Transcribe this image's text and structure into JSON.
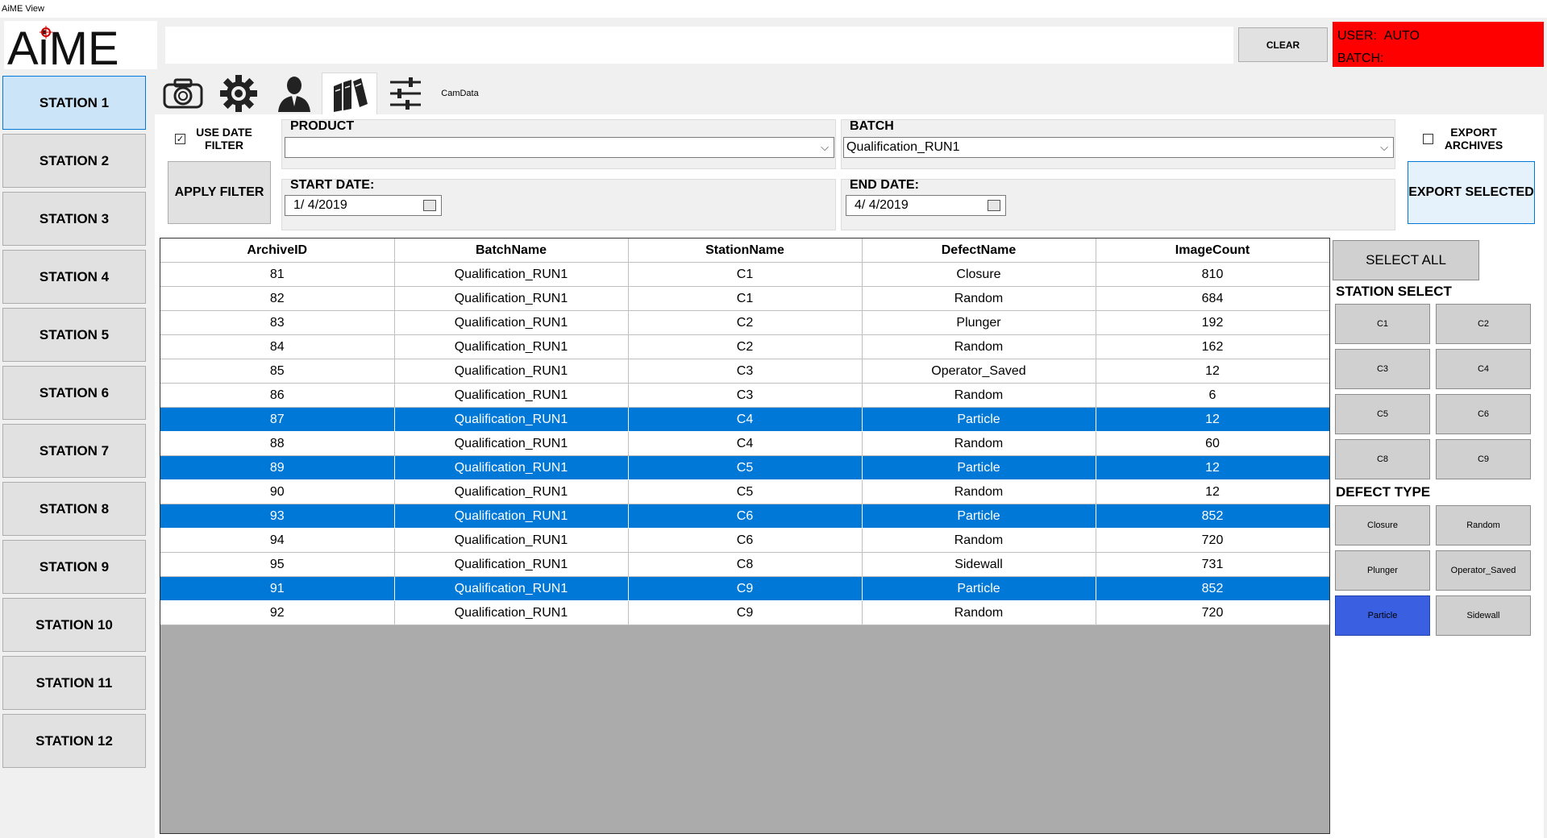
{
  "window": {
    "title": "AiME View"
  },
  "logo": {
    "text": "AiME"
  },
  "header": {
    "clear_label": "CLEAR",
    "user_label": "USER:",
    "user_value": "AUTO",
    "batch_label": "BATCH:",
    "batch_value": ""
  },
  "stations": [
    "STATION 1",
    "STATION 2",
    "STATION 3",
    "STATION 4",
    "STATION 5",
    "STATION 6",
    "STATION 7",
    "STATION 8",
    "STATION 9",
    "STATION 10",
    "STATION 11",
    "STATION 12"
  ],
  "tabs": [
    {
      "icon": "camera-icon"
    },
    {
      "icon": "gear-icon"
    },
    {
      "icon": "user-icon"
    },
    {
      "icon": "archive-books-icon"
    },
    {
      "icon": "sliders-icon"
    },
    {
      "label": "CamData"
    }
  ],
  "filters": {
    "use_date_filter_label": "USE DATE FILTER",
    "use_date_filter_checked": true,
    "apply_filter_label": "APPLY FILTER",
    "product_label": "PRODUCT",
    "product_value": "",
    "batch_label": "BATCH",
    "batch_value": "Qualification_RUN1",
    "start_date_label": "START DATE:",
    "start_date_value": "1/  4/2019",
    "end_date_label": "END DATE:",
    "end_date_value": "4/  4/2019",
    "export_archives_label": "EXPORT ARCHIVES",
    "export_archives_checked": false,
    "export_selected_label": "EXPORT SELECTED"
  },
  "grid": {
    "columns": [
      "ArchiveID",
      "BatchName",
      "StationName",
      "DefectName",
      "ImageCount"
    ],
    "rows": [
      {
        "id": "81",
        "batch": "Qualification_RUN1",
        "station": "C1",
        "defect": "Closure",
        "count": "810",
        "selected": false
      },
      {
        "id": "82",
        "batch": "Qualification_RUN1",
        "station": "C1",
        "defect": "Random",
        "count": "684",
        "selected": false
      },
      {
        "id": "83",
        "batch": "Qualification_RUN1",
        "station": "C2",
        "defect": "Plunger",
        "count": "192",
        "selected": false
      },
      {
        "id": "84",
        "batch": "Qualification_RUN1",
        "station": "C2",
        "defect": "Random",
        "count": "162",
        "selected": false
      },
      {
        "id": "85",
        "batch": "Qualification_RUN1",
        "station": "C3",
        "defect": "Operator_Saved",
        "count": "12",
        "selected": false
      },
      {
        "id": "86",
        "batch": "Qualification_RUN1",
        "station": "C3",
        "defect": "Random",
        "count": "6",
        "selected": false
      },
      {
        "id": "87",
        "batch": "Qualification_RUN1",
        "station": "C4",
        "defect": "Particle",
        "count": "12",
        "selected": true
      },
      {
        "id": "88",
        "batch": "Qualification_RUN1",
        "station": "C4",
        "defect": "Random",
        "count": "60",
        "selected": false
      },
      {
        "id": "89",
        "batch": "Qualification_RUN1",
        "station": "C5",
        "defect": "Particle",
        "count": "12",
        "selected": true
      },
      {
        "id": "90",
        "batch": "Qualification_RUN1",
        "station": "C5",
        "defect": "Random",
        "count": "12",
        "selected": false
      },
      {
        "id": "93",
        "batch": "Qualification_RUN1",
        "station": "C6",
        "defect": "Particle",
        "count": "852",
        "selected": true
      },
      {
        "id": "94",
        "batch": "Qualification_RUN1",
        "station": "C6",
        "defect": "Random",
        "count": "720",
        "selected": false
      },
      {
        "id": "95",
        "batch": "Qualification_RUN1",
        "station": "C8",
        "defect": "Sidewall",
        "count": "731",
        "selected": false
      },
      {
        "id": "91",
        "batch": "Qualification_RUN1",
        "station": "C9",
        "defect": "Particle",
        "count": "852",
        "selected": true
      },
      {
        "id": "92",
        "batch": "Qualification_RUN1",
        "station": "C9",
        "defect": "Random",
        "count": "720",
        "selected": false
      }
    ]
  },
  "right_panel": {
    "select_all_label": "SELECT ALL",
    "station_select_label": "STATION SELECT",
    "stations": [
      "C1",
      "C2",
      "C3",
      "C4",
      "C5",
      "C6",
      "C8",
      "C9"
    ],
    "defect_type_label": "DEFECT TYPE",
    "defects": [
      {
        "label": "Closure",
        "on": false
      },
      {
        "label": "Random",
        "on": false
      },
      {
        "label": "Plunger",
        "on": false
      },
      {
        "label": "Operator_Saved",
        "on": false
      },
      {
        "label": "Particle",
        "on": true
      },
      {
        "label": "Sidewall",
        "on": false
      }
    ]
  },
  "colors": {
    "selection": "#0078d7",
    "user_panel": "#ff0000",
    "defect_on": "#3a5fe0"
  }
}
